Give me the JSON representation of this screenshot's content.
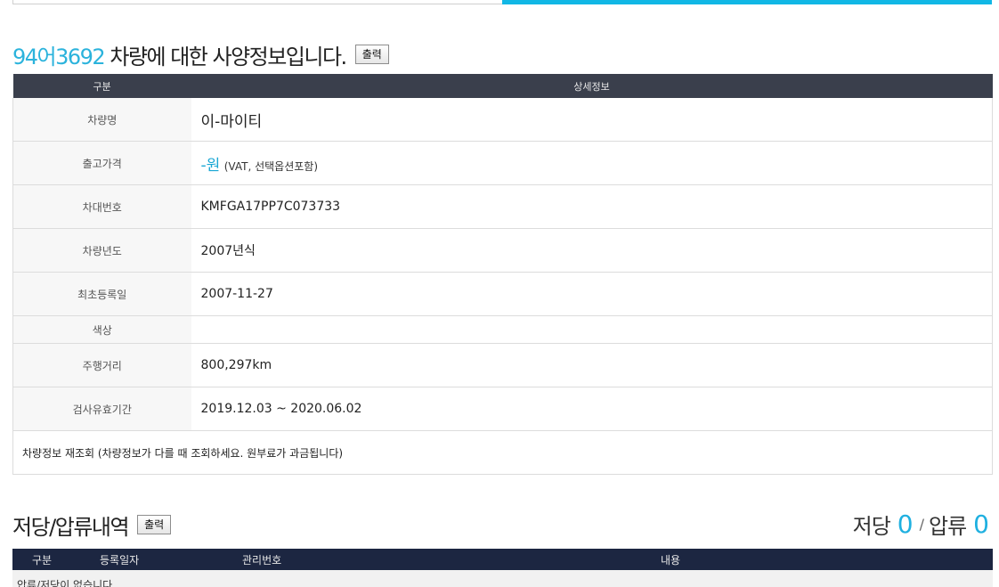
{
  "title": {
    "plate": "94어3692",
    "text": " 차량에 대한 사양정보입니다.",
    "print_button": "출력"
  },
  "spec_table": {
    "headers": [
      "구분",
      "상세정보"
    ],
    "rows": [
      {
        "label": "차량명",
        "value": "이-마이티"
      },
      {
        "label": "출고가격",
        "value": "-원",
        "note": "(VAT, 선택옵션포함)"
      },
      {
        "label": "차대번호",
        "value": "KMFGA17PP7C073733"
      },
      {
        "label": "차량년도",
        "value": "2007년식"
      },
      {
        "label": "최초등록일",
        "value": "2007-11-27"
      },
      {
        "label": "색상",
        "value": ""
      },
      {
        "label": "주행거리",
        "value": "800,297km"
      },
      {
        "label": "검사유효기간",
        "value": "2019.12.03 ~ 2020.06.02"
      }
    ],
    "footer": "차량정보 재조회 (차량정보가 다를 때 조회하세요. 원부료가 과금됩니다)"
  },
  "lien": {
    "title": "저당/압류내역",
    "print_button": "출력",
    "mortgage_label": "저당",
    "mortgage_count": "0",
    "separator": "/",
    "seizure_label": "압류",
    "seizure_count": "0",
    "headers": [
      "구분",
      "등록일자",
      "관리번호",
      "내용"
    ],
    "empty_text": "압류/저당이 없습니다"
  },
  "colors": {
    "accent": "#11b7e5",
    "table_header": "#3a3f4c",
    "lien_header": "#1c2641"
  }
}
